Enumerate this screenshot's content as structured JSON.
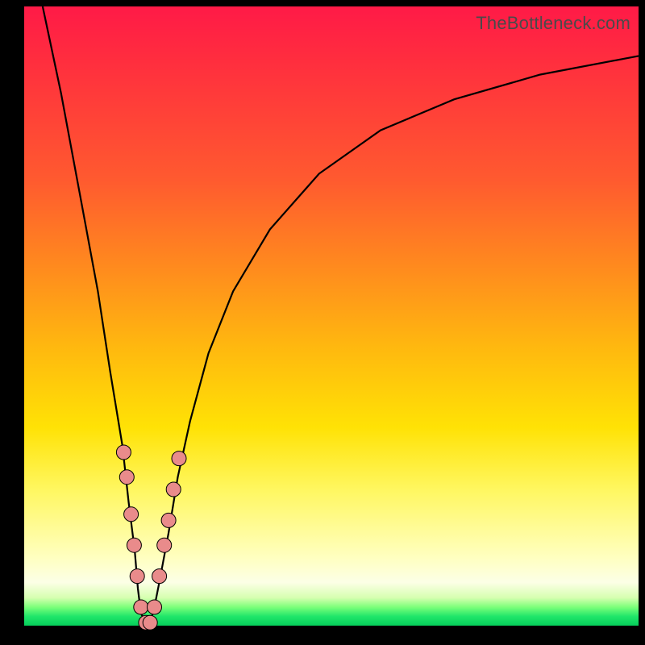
{
  "watermark": "TheBottleneck.com",
  "chart_data": {
    "type": "line",
    "title": "",
    "xlabel": "",
    "ylabel": "",
    "xlim": [
      0,
      100
    ],
    "ylim": [
      0,
      100
    ],
    "series": [
      {
        "name": "bottleneck-curve",
        "x": [
          3,
          6,
          9,
          12,
          14,
          16,
          17,
          18,
          18.5,
          19,
          20,
          21,
          22,
          23.5,
          25,
          27,
          30,
          34,
          40,
          48,
          58,
          70,
          84,
          100
        ],
        "values": [
          100,
          86,
          70,
          54,
          41,
          29,
          20,
          12,
          6,
          2,
          0,
          2,
          7,
          15,
          24,
          33,
          44,
          54,
          64,
          73,
          80,
          85,
          89,
          92
        ]
      }
    ],
    "markers": {
      "name": "highlight-dots",
      "color": "#e98b8b",
      "points": [
        {
          "x": 16.2,
          "y": 28
        },
        {
          "x": 16.7,
          "y": 24
        },
        {
          "x": 17.4,
          "y": 18
        },
        {
          "x": 17.9,
          "y": 13
        },
        {
          "x": 18.4,
          "y": 8
        },
        {
          "x": 19.0,
          "y": 3
        },
        {
          "x": 19.8,
          "y": 0.5
        },
        {
          "x": 20.5,
          "y": 0.5
        },
        {
          "x": 21.2,
          "y": 3
        },
        {
          "x": 22.0,
          "y": 8
        },
        {
          "x": 22.8,
          "y": 13
        },
        {
          "x": 23.5,
          "y": 17
        },
        {
          "x": 24.3,
          "y": 22
        },
        {
          "x": 25.2,
          "y": 27
        }
      ]
    }
  },
  "colors": {
    "marker_fill": "#e98b8b",
    "marker_stroke": "#000000",
    "curve_stroke": "#000000"
  }
}
